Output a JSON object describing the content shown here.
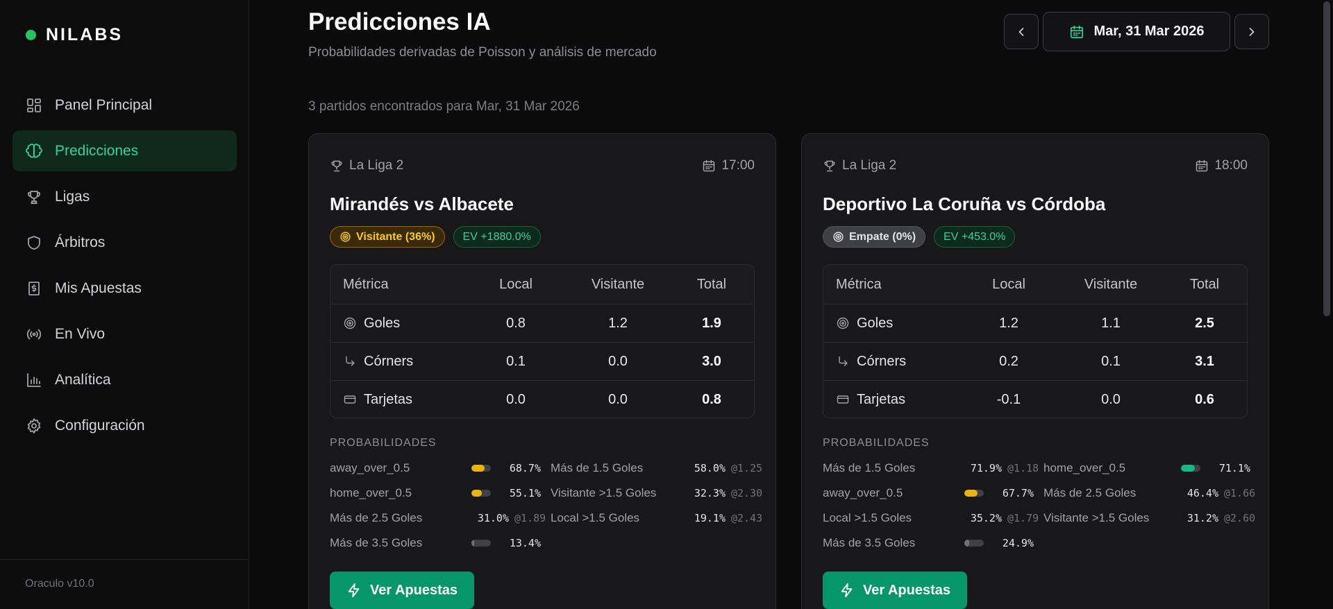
{
  "brand": {
    "name": "NILABS",
    "dot_color": "#22c55e"
  },
  "nav": {
    "items": [
      {
        "label": "Panel Principal",
        "icon": "dashboard-icon",
        "active": false
      },
      {
        "label": "Predicciones",
        "icon": "brain-icon",
        "active": true
      },
      {
        "label": "Ligas",
        "icon": "trophy-icon",
        "active": false
      },
      {
        "label": "Árbitros",
        "icon": "shield-icon",
        "active": false
      },
      {
        "label": "Mis Apuestas",
        "icon": "receipt-dollar-icon",
        "active": false
      },
      {
        "label": "En Vivo",
        "icon": "broadcast-icon",
        "active": false
      },
      {
        "label": "Analítica",
        "icon": "bar-chart-icon",
        "active": false
      },
      {
        "label": "Configuración",
        "icon": "gear-icon",
        "active": false
      }
    ],
    "version": "Oraculo v10.0"
  },
  "header": {
    "title": "Predicciones IA",
    "subtitle": "Probabilidades derivadas de Poisson y análisis de mercado",
    "date_label": "Mar, 31 Mar 2026",
    "prev_icon": "chevron-left-icon",
    "next_icon": "chevron-right-icon"
  },
  "results_text": "3 partidos encontrados para Mar, 31 Mar 2026",
  "colors": {
    "accent": "#34d399",
    "yellow": "#facc15",
    "green_bar": "#10b981",
    "button": "#059669"
  },
  "matches": [
    {
      "league": "La Liga 2",
      "time": "17:00",
      "title": "Mirandés vs Albacete",
      "pick_badge": "Visitante (36%)",
      "pick_style": "yellow",
      "ev_badge": "EV +1880.0%",
      "metrics_header": [
        "Métrica",
        "Local",
        "Visitante",
        "Total"
      ],
      "metrics": [
        {
          "name": "Goles",
          "icon": "target-icon",
          "local": "0.8",
          "visitante": "1.2",
          "total": "1.9"
        },
        {
          "name": "Córners",
          "icon": "corner-arrow-icon",
          "local": "0.1",
          "visitante": "0.0",
          "total": "3.0"
        },
        {
          "name": "Tarjetas",
          "icon": "card-icon",
          "local": "0.0",
          "visitante": "0.0",
          "total": "0.8"
        }
      ],
      "prob_title": "PROBABILIDADES",
      "probabilities": [
        {
          "label": "away_over_0.5",
          "value": "68.7%",
          "bar": 0.687,
          "bar_color": "#eab308",
          "odds": ""
        },
        {
          "label": "Más de 1.5 Goles",
          "value": "58.0%",
          "odds": "@1.25"
        },
        {
          "label": "home_over_0.5",
          "value": "55.1%",
          "bar": 0.551,
          "bar_color": "#eab308",
          "odds": ""
        },
        {
          "label": "Visitante >1.5 Goles",
          "value": "32.3%",
          "odds": "@2.30"
        },
        {
          "label": "Más de 2.5 Goles",
          "value": "31.0%",
          "odds": "@1.89"
        },
        {
          "label": "Local >1.5 Goles",
          "value": "19.1%",
          "odds": "@2.43"
        },
        {
          "label": "Más de 3.5 Goles",
          "value": "13.4%",
          "bar": 0.134,
          "bar_color": "#71717a",
          "odds": ""
        }
      ],
      "button_label": "Ver Apuestas"
    },
    {
      "league": "La Liga 2",
      "time": "18:00",
      "title": "Deportivo La Coruña vs Córdoba",
      "pick_badge": "Empate (0%)",
      "pick_style": "gray",
      "ev_badge": "EV +453.0%",
      "metrics_header": [
        "Métrica",
        "Local",
        "Visitante",
        "Total"
      ],
      "metrics": [
        {
          "name": "Goles",
          "icon": "target-icon",
          "local": "1.2",
          "visitante": "1.1",
          "total": "2.5"
        },
        {
          "name": "Córners",
          "icon": "corner-arrow-icon",
          "local": "0.2",
          "visitante": "0.1",
          "total": "3.1"
        },
        {
          "name": "Tarjetas",
          "icon": "card-icon",
          "local": "-0.1",
          "visitante": "0.0",
          "total": "0.6"
        }
      ],
      "prob_title": "PROBABILIDADES",
      "probabilities": [
        {
          "label": "Más de 1.5 Goles",
          "value": "71.9%",
          "odds": "@1.18"
        },
        {
          "label": "home_over_0.5",
          "value": "71.1%",
          "bar": 0.711,
          "bar_color": "#10b981",
          "odds": ""
        },
        {
          "label": "away_over_0.5",
          "value": "67.7%",
          "bar": 0.677,
          "bar_color": "#eab308",
          "odds": ""
        },
        {
          "label": "Más de 2.5 Goles",
          "value": "46.4%",
          "odds": "@1.66"
        },
        {
          "label": "Local >1.5 Goles",
          "value": "35.2%",
          "odds": "@1.79"
        },
        {
          "label": "Visitante >1.5 Goles",
          "value": "31.2%",
          "odds": "@2.60"
        },
        {
          "label": "Más de 3.5 Goles",
          "value": "24.9%",
          "bar": 0.249,
          "bar_color": "#71717a",
          "odds": ""
        }
      ],
      "button_label": "Ver Apuestas"
    }
  ]
}
